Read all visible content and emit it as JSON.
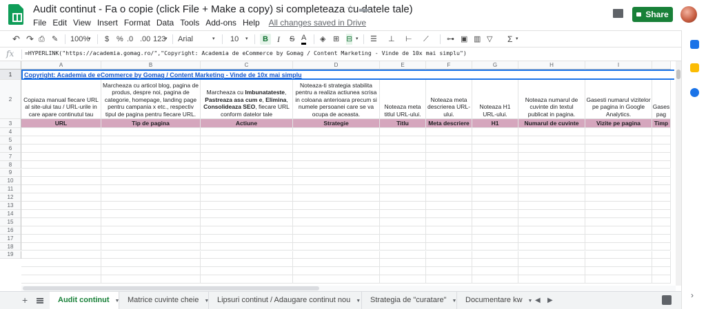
{
  "header": {
    "title": "Audit continut - Fa o copie (click File + Make a copy) si completeaza cu datele tale)",
    "menu": [
      "File",
      "Edit",
      "View",
      "Insert",
      "Format",
      "Data",
      "Tools",
      "Add-ons",
      "Help"
    ],
    "saved_status": "All changes saved in Drive",
    "share_label": "Share"
  },
  "toolbar": {
    "zoom": "100%",
    "currency": "$",
    "percent": "%",
    "dec_decrease": ".0",
    "dec_increase": ".00",
    "more_formats": "123",
    "font": "Arial",
    "font_size": "10",
    "bold": "B",
    "italic": "I",
    "strike": "S",
    "text_color": "A",
    "sum": "Σ"
  },
  "formula": {
    "fx": "fx",
    "text": "=HYPERLINK(\"https://academia.gomag.ro/\",\"Copyright: Academia de eCommerce by Gomag / Content Marketing - Vinde de 10x mai simplu\")"
  },
  "grid": {
    "columns": [
      "A",
      "B",
      "C",
      "D",
      "E",
      "F",
      "G",
      "H",
      "I"
    ],
    "rows": [
      "1",
      "2",
      "3",
      "4",
      "5",
      "6",
      "7",
      "8",
      "9",
      "10",
      "11",
      "12",
      "13",
      "14",
      "15",
      "16",
      "17",
      "18",
      "19"
    ],
    "row1_link": "Copyright: Academia de eCommerce by Gomag / Content Marketing - Vinde de 10x mai simplu",
    "descriptions": [
      "Copiaza manual fiecare URL al site-ului tau / URL-urile in care apare continutul tau",
      "Marcheaza cu articol blog, pagina de produs, despre noi, pagina de categorie, homepage, landing page pentru campania x etc., respectiv tipul de pagina pentru fiecare URL.",
      "",
      "Noteaza-ti strategia stabilita pentru a realiza actiunea scrisa in coloana anterioara precum si numele persoanei care se va ocupa de aceasta.",
      "Noteaza meta titlul URL-ului.",
      "Noteaza meta descrierea URL-ului.",
      "Noteaza H1 URL-ului.",
      "Noteaza numarul de cuvinte din textul publicat in pagina.",
      "Gasesti numarul vizitelor pe pagina in Google Analytics.",
      "Gases pag"
    ],
    "desc_c": {
      "p1": "Marcheaza cu ",
      "b1": "Imbunatateste",
      "p2": ", ",
      "b2": "Pastreaza asa cum e",
      "p3": ", ",
      "b3": "Elimina",
      "p4": ", ",
      "b4": "Consolideaza SEO",
      "p5": ", fiecare URL conform datelor tale"
    },
    "headers": [
      "URL",
      "Tip de pagina",
      "Actiune",
      "Strategie",
      "Titlu",
      "Meta descriere",
      "H1",
      "Numarul de cuvinte",
      "Vizite pe pagina",
      "Timp"
    ],
    "header_color": "#d5a6bd"
  },
  "tabs": [
    {
      "label": "Audit continut",
      "active": true
    },
    {
      "label": "Matrice cuvinte cheie",
      "active": false
    },
    {
      "label": "Lipsuri continut / Adaugare continut nou",
      "active": false
    },
    {
      "label": "Strategia de \"curatare\"",
      "active": false
    },
    {
      "label": "Documentare kw",
      "active": false
    }
  ],
  "colors": {
    "accent": "#188038",
    "selection": "#1a73e8",
    "link": "#1155cc"
  }
}
